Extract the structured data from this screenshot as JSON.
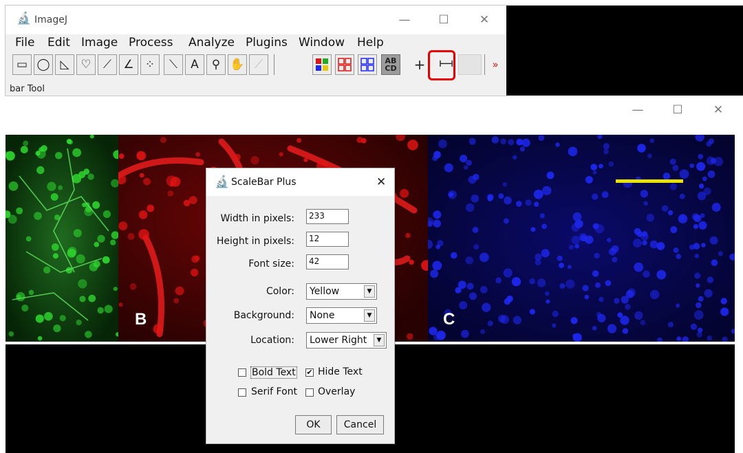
{
  "imagej": {
    "title": "ImageJ",
    "window_controls": {
      "minimize": "—",
      "maximize": "☐",
      "close": "✕"
    },
    "menu": [
      "File",
      "Edit",
      "Image",
      "Process",
      "Analyze",
      "Plugins",
      "Window",
      "Help"
    ],
    "tools": [
      {
        "name": "rectangle-tool",
        "glyph": "▭"
      },
      {
        "name": "oval-tool",
        "glyph": "◯"
      },
      {
        "name": "polygon-tool",
        "glyph": "◺"
      },
      {
        "name": "freehand-tool",
        "glyph": "♡"
      },
      {
        "name": "line-tool",
        "glyph": "⟋"
      },
      {
        "name": "angle-tool",
        "glyph": "∠"
      },
      {
        "name": "point-tool",
        "glyph": "⁘"
      },
      {
        "name": "wand-tool",
        "glyph": "⟍"
      },
      {
        "name": "text-tool",
        "glyph": "A"
      },
      {
        "name": "magnifier-tool",
        "glyph": "⚲"
      },
      {
        "name": "hand-tool",
        "glyph": "✋"
      },
      {
        "name": "dropper-tool",
        "glyph": "⟋"
      }
    ],
    "label_tool": {
      "line1": "AB",
      "line2": "CD"
    },
    "crosshair_glyph": "+",
    "scalebar_tool_glyph": "⊢⊣",
    "more_glyph": "»",
    "status": "bar Tool"
  },
  "image_window": {
    "window_controls": {
      "minimize": "—",
      "maximize": "☐",
      "close": "✕"
    },
    "panel_letters": {
      "b": "B",
      "c": "C"
    },
    "scalebar_color": "#e8e200"
  },
  "dialog": {
    "title": "ScaleBar Plus",
    "close": "✕",
    "fields": {
      "width_label": "Width in pixels:",
      "width_value": "233",
      "height_label": "Height in pixels:",
      "height_value": "12",
      "font_label": "Font size:",
      "font_value": "42"
    },
    "selects": {
      "color_label": "Color:",
      "color_value": "Yellow",
      "background_label": "Background:",
      "background_value": "None",
      "location_label": "Location:",
      "location_value": "Lower Right"
    },
    "checkboxes": {
      "bold_text": "Bold Text",
      "bold_checked": "",
      "hide_text": "Hide Text",
      "hide_checked": "✔",
      "serif_font": "Serif Font",
      "serif_checked": "",
      "overlay": "Overlay",
      "overlay_checked": ""
    },
    "buttons": {
      "ok": "OK",
      "cancel": "Cancel"
    }
  },
  "colors": {
    "highlight": "#e60000",
    "green_channel": "#2fd82f",
    "red_channel": "#e01414",
    "blue_channel": "#1e28f0"
  }
}
